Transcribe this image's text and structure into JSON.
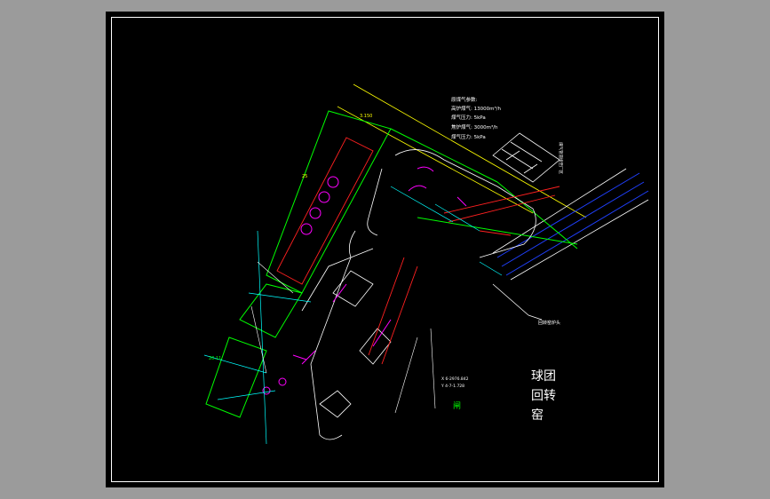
{
  "drawing": {
    "notes": {
      "header": "原煤气参数:",
      "line1": "高炉煤气: 13000m³/h",
      "line2": "煤气压力: 5kPa",
      "line3": "焦炉煤气: 3000m³/h",
      "line4": "煤气压力: 5kPa"
    },
    "vertical_text": "煤气管道接至厂区",
    "title_chars": [
      "球团",
      "回转",
      "窑"
    ],
    "gate_label": "闸",
    "side_note": "回转窑炉头",
    "coord_line1": "X 6-2976.842",
    "coord_line2": "Y 4-7-1.728",
    "label_left_dim": "20.11",
    "label_dim_3150": "3.150",
    "label_dim_25": "25",
    "colors": {
      "background": "#000000",
      "frame": "#ffffff",
      "green": "#00ff00",
      "red": "#ff2020",
      "magenta": "#ff00ff",
      "cyan": "#00ffff",
      "yellow": "#ffff00",
      "white": "#ffffff",
      "blue": "#2040ff"
    }
  }
}
